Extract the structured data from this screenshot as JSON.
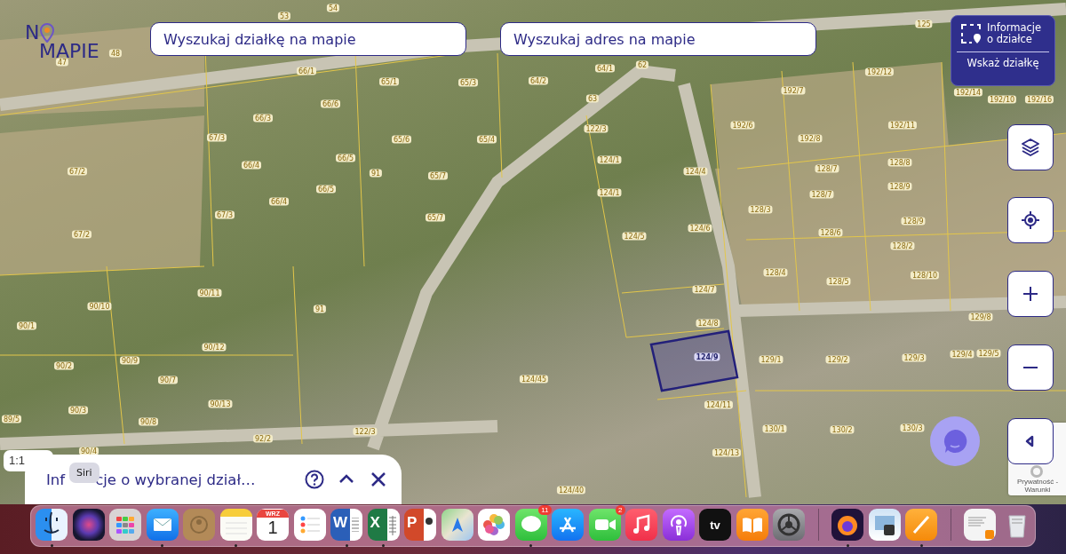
{
  "logo": {
    "text_start": "N",
    "text_end": "MAPIE"
  },
  "search_fields": [
    {
      "placeholder": "Wyszukaj działkę na mapie"
    },
    {
      "placeholder": "Wyszukaj adres na mapie"
    }
  ],
  "info_panel": {
    "title": "Informacje o działce",
    "action": "Wskaż działkę"
  },
  "map_buttons": [
    {
      "kind": "layers"
    },
    {
      "kind": "locate"
    },
    {
      "kind": "zoom_in"
    },
    {
      "kind": "zoom_out"
    },
    {
      "kind": "collapse"
    }
  ],
  "scale": "1:1",
  "parcel_panel": {
    "title_start": "Inf",
    "title_end": "cje o wybranej dział…"
  },
  "tooltip": "Siri",
  "recaptcha": "Prywatność - Warunki",
  "parcels": [
    {
      "label": "53",
      "selected": false
    },
    {
      "label": "54",
      "selected": false
    },
    {
      "label": "47",
      "selected": false
    },
    {
      "label": "48",
      "selected": false
    },
    {
      "label": "66/1",
      "selected": false
    },
    {
      "label": "65/1",
      "selected": false
    },
    {
      "label": "65/3",
      "selected": false
    },
    {
      "label": "66/6",
      "selected": false
    },
    {
      "label": "64/2",
      "selected": false
    },
    {
      "label": "64/1",
      "selected": false
    },
    {
      "label": "62",
      "selected": false
    },
    {
      "label": "63",
      "selected": false
    },
    {
      "label": "125",
      "selected": false
    },
    {
      "label": "192/10",
      "selected": false
    },
    {
      "label": "192/12",
      "selected": false
    },
    {
      "label": "192/16",
      "selected": false
    },
    {
      "label": "192/7",
      "selected": false
    },
    {
      "label": "192/14",
      "selected": false
    },
    {
      "label": "192/6",
      "selected": false
    },
    {
      "label": "192/8",
      "selected": false
    },
    {
      "label": "192/11",
      "selected": false
    },
    {
      "label": "66/3",
      "selected": false
    },
    {
      "label": "67/3",
      "selected": false
    },
    {
      "label": "65/6",
      "selected": false
    },
    {
      "label": "65/4",
      "selected": false
    },
    {
      "label": "122/3",
      "selected": false
    },
    {
      "label": "124/1",
      "selected": false
    },
    {
      "label": "124/4",
      "selected": false
    },
    {
      "label": "66/4",
      "selected": false
    },
    {
      "label": "66/5",
      "selected": false
    },
    {
      "label": "91",
      "selected": false
    },
    {
      "label": "65/7",
      "selected": false
    },
    {
      "label": "65/7",
      "selected": false
    },
    {
      "label": "124/1",
      "selected": false
    },
    {
      "label": "128/7",
      "selected": false
    },
    {
      "label": "128/8",
      "selected": false
    },
    {
      "label": "128/7",
      "selected": false
    },
    {
      "label": "128/9",
      "selected": false
    },
    {
      "label": "66/5",
      "selected": false
    },
    {
      "label": "66/4",
      "selected": false
    },
    {
      "label": "67/2",
      "selected": false
    },
    {
      "label": "67/3",
      "selected": false
    },
    {
      "label": "128/3",
      "selected": false
    },
    {
      "label": "124/6",
      "selected": false
    },
    {
      "label": "124/5",
      "selected": false
    },
    {
      "label": "128/6",
      "selected": false
    },
    {
      "label": "128/2",
      "selected": false
    },
    {
      "label": "128/9",
      "selected": false
    },
    {
      "label": "67/2",
      "selected": false
    },
    {
      "label": "128/4",
      "selected": false
    },
    {
      "label": "128/5",
      "selected": false
    },
    {
      "label": "128/10",
      "selected": false
    },
    {
      "label": "124/7",
      "selected": false
    },
    {
      "label": "90/11",
      "selected": false
    },
    {
      "label": "90/10",
      "selected": false
    },
    {
      "label": "91",
      "selected": false
    },
    {
      "label": "124/8",
      "selected": false
    },
    {
      "label": "129/8",
      "selected": false
    },
    {
      "label": "90/1",
      "selected": false
    },
    {
      "label": "90/12",
      "selected": false
    },
    {
      "label": "90/9",
      "selected": false
    },
    {
      "label": "124/9",
      "selected": true
    },
    {
      "label": "129/1",
      "selected": false
    },
    {
      "label": "129/2",
      "selected": false
    },
    {
      "label": "129/3",
      "selected": false
    },
    {
      "label": "129/4",
      "selected": false
    },
    {
      "label": "129/5",
      "selected": false
    },
    {
      "label": "90/2",
      "selected": false
    },
    {
      "label": "90/7",
      "selected": false
    },
    {
      "label": "124/45",
      "selected": false
    },
    {
      "label": "90/3",
      "selected": false
    },
    {
      "label": "90/13",
      "selected": false
    },
    {
      "label": "124/11",
      "selected": false
    },
    {
      "label": "90/8",
      "selected": false
    },
    {
      "label": "89/5",
      "selected": false
    },
    {
      "label": "130/1",
      "selected": false
    },
    {
      "label": "130/2",
      "selected": false
    },
    {
      "label": "130/3",
      "selected": false
    },
    {
      "label": "92/2",
      "selected": false
    },
    {
      "label": "122/3",
      "selected": false
    },
    {
      "label": "124/13",
      "selected": false
    },
    {
      "label": "124/40",
      "selected": false
    },
    {
      "label": "90/4",
      "selected": false
    }
  ],
  "dock": [
    {
      "kind": "finder",
      "running": true
    },
    {
      "kind": "siri",
      "running": false
    },
    {
      "kind": "launchpad",
      "running": false
    },
    {
      "kind": "mail",
      "running": true
    },
    {
      "kind": "contacts",
      "running": false
    },
    {
      "kind": "notes",
      "running": true
    },
    {
      "kind": "calendar",
      "month": "WRZ",
      "day": "1",
      "running": false
    },
    {
      "kind": "reminders",
      "running": false
    },
    {
      "kind": "word",
      "glyph": "W",
      "running": true
    },
    {
      "kind": "excel",
      "glyph": "X",
      "running": true
    },
    {
      "kind": "powerpoint",
      "glyph": "P",
      "running": false
    },
    {
      "kind": "maps",
      "running": false
    },
    {
      "kind": "photos",
      "running": false
    },
    {
      "kind": "messages",
      "badge": "11",
      "running": true
    },
    {
      "kind": "appstore",
      "running": false
    },
    {
      "kind": "facetime",
      "badge": "2",
      "running": false
    },
    {
      "kind": "music",
      "running": false
    },
    {
      "kind": "podcasts",
      "running": false
    },
    {
      "kind": "tv",
      "glyph": "tv",
      "running": false
    },
    {
      "kind": "books",
      "running": false
    },
    {
      "kind": "settings",
      "running": false
    },
    {
      "kind": "separator",
      "running": false
    },
    {
      "kind": "firefox",
      "running": true
    },
    {
      "kind": "preview",
      "running": false
    },
    {
      "kind": "pages",
      "running": true
    },
    {
      "kind": "separator",
      "running": false
    },
    {
      "kind": "document",
      "running": false
    },
    {
      "kind": "trash",
      "running": false
    }
  ]
}
